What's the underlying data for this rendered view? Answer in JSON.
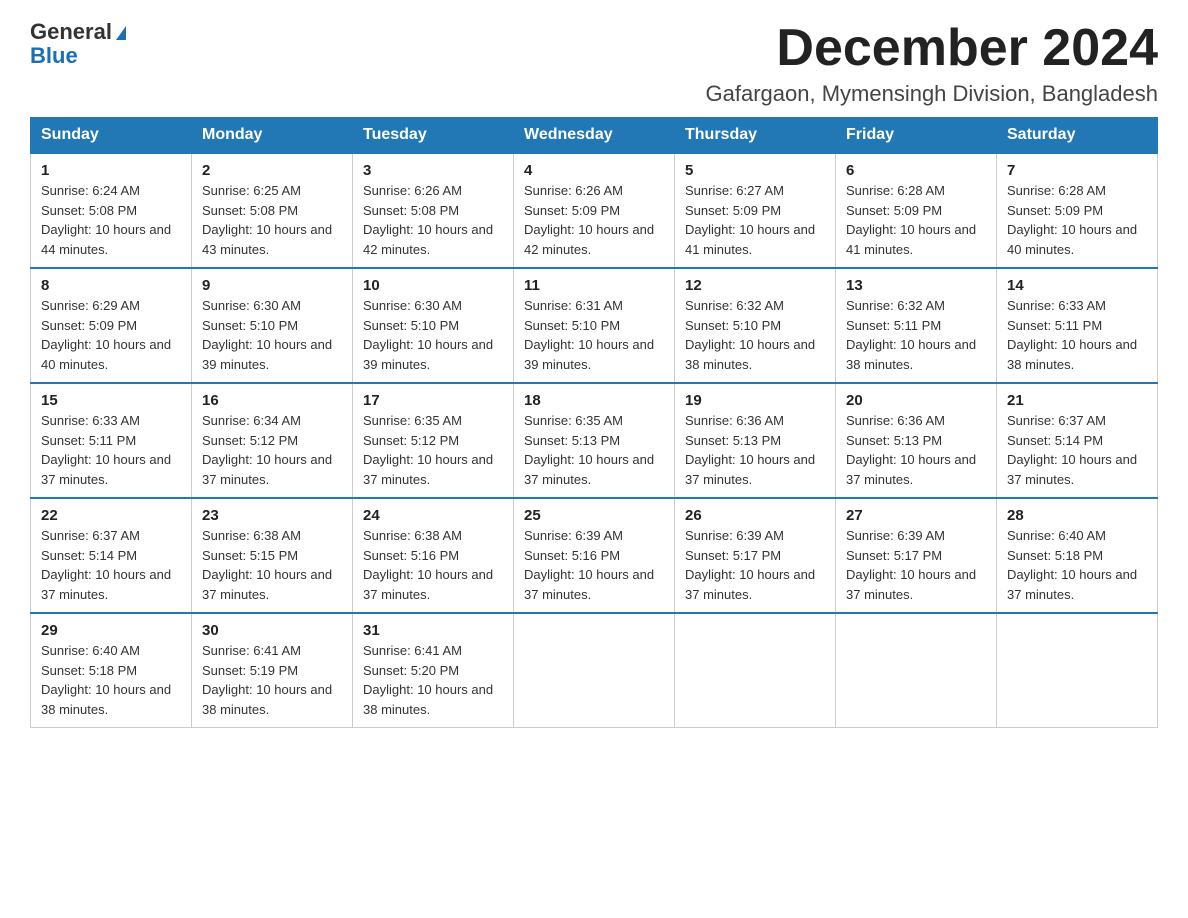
{
  "header": {
    "logo_general": "General",
    "logo_blue": "Blue",
    "month_title": "December 2024",
    "location": "Gafargaon, Mymensingh Division, Bangladesh"
  },
  "weekdays": [
    "Sunday",
    "Monday",
    "Tuesday",
    "Wednesday",
    "Thursday",
    "Friday",
    "Saturday"
  ],
  "weeks": [
    [
      {
        "day": 1,
        "sunrise": "6:24 AM",
        "sunset": "5:08 PM",
        "daylight": "10 hours and 44 minutes."
      },
      {
        "day": 2,
        "sunrise": "6:25 AM",
        "sunset": "5:08 PM",
        "daylight": "10 hours and 43 minutes."
      },
      {
        "day": 3,
        "sunrise": "6:26 AM",
        "sunset": "5:08 PM",
        "daylight": "10 hours and 42 minutes."
      },
      {
        "day": 4,
        "sunrise": "6:26 AM",
        "sunset": "5:09 PM",
        "daylight": "10 hours and 42 minutes."
      },
      {
        "day": 5,
        "sunrise": "6:27 AM",
        "sunset": "5:09 PM",
        "daylight": "10 hours and 41 minutes."
      },
      {
        "day": 6,
        "sunrise": "6:28 AM",
        "sunset": "5:09 PM",
        "daylight": "10 hours and 41 minutes."
      },
      {
        "day": 7,
        "sunrise": "6:28 AM",
        "sunset": "5:09 PM",
        "daylight": "10 hours and 40 minutes."
      }
    ],
    [
      {
        "day": 8,
        "sunrise": "6:29 AM",
        "sunset": "5:09 PM",
        "daylight": "10 hours and 40 minutes."
      },
      {
        "day": 9,
        "sunrise": "6:30 AM",
        "sunset": "5:10 PM",
        "daylight": "10 hours and 39 minutes."
      },
      {
        "day": 10,
        "sunrise": "6:30 AM",
        "sunset": "5:10 PM",
        "daylight": "10 hours and 39 minutes."
      },
      {
        "day": 11,
        "sunrise": "6:31 AM",
        "sunset": "5:10 PM",
        "daylight": "10 hours and 39 minutes."
      },
      {
        "day": 12,
        "sunrise": "6:32 AM",
        "sunset": "5:10 PM",
        "daylight": "10 hours and 38 minutes."
      },
      {
        "day": 13,
        "sunrise": "6:32 AM",
        "sunset": "5:11 PM",
        "daylight": "10 hours and 38 minutes."
      },
      {
        "day": 14,
        "sunrise": "6:33 AM",
        "sunset": "5:11 PM",
        "daylight": "10 hours and 38 minutes."
      }
    ],
    [
      {
        "day": 15,
        "sunrise": "6:33 AM",
        "sunset": "5:11 PM",
        "daylight": "10 hours and 37 minutes."
      },
      {
        "day": 16,
        "sunrise": "6:34 AM",
        "sunset": "5:12 PM",
        "daylight": "10 hours and 37 minutes."
      },
      {
        "day": 17,
        "sunrise": "6:35 AM",
        "sunset": "5:12 PM",
        "daylight": "10 hours and 37 minutes."
      },
      {
        "day": 18,
        "sunrise": "6:35 AM",
        "sunset": "5:13 PM",
        "daylight": "10 hours and 37 minutes."
      },
      {
        "day": 19,
        "sunrise": "6:36 AM",
        "sunset": "5:13 PM",
        "daylight": "10 hours and 37 minutes."
      },
      {
        "day": 20,
        "sunrise": "6:36 AM",
        "sunset": "5:13 PM",
        "daylight": "10 hours and 37 minutes."
      },
      {
        "day": 21,
        "sunrise": "6:37 AM",
        "sunset": "5:14 PM",
        "daylight": "10 hours and 37 minutes."
      }
    ],
    [
      {
        "day": 22,
        "sunrise": "6:37 AM",
        "sunset": "5:14 PM",
        "daylight": "10 hours and 37 minutes."
      },
      {
        "day": 23,
        "sunrise": "6:38 AM",
        "sunset": "5:15 PM",
        "daylight": "10 hours and 37 minutes."
      },
      {
        "day": 24,
        "sunrise": "6:38 AM",
        "sunset": "5:16 PM",
        "daylight": "10 hours and 37 minutes."
      },
      {
        "day": 25,
        "sunrise": "6:39 AM",
        "sunset": "5:16 PM",
        "daylight": "10 hours and 37 minutes."
      },
      {
        "day": 26,
        "sunrise": "6:39 AM",
        "sunset": "5:17 PM",
        "daylight": "10 hours and 37 minutes."
      },
      {
        "day": 27,
        "sunrise": "6:39 AM",
        "sunset": "5:17 PM",
        "daylight": "10 hours and 37 minutes."
      },
      {
        "day": 28,
        "sunrise": "6:40 AM",
        "sunset": "5:18 PM",
        "daylight": "10 hours and 37 minutes."
      }
    ],
    [
      {
        "day": 29,
        "sunrise": "6:40 AM",
        "sunset": "5:18 PM",
        "daylight": "10 hours and 38 minutes."
      },
      {
        "day": 30,
        "sunrise": "6:41 AM",
        "sunset": "5:19 PM",
        "daylight": "10 hours and 38 minutes."
      },
      {
        "day": 31,
        "sunrise": "6:41 AM",
        "sunset": "5:20 PM",
        "daylight": "10 hours and 38 minutes."
      },
      null,
      null,
      null,
      null
    ]
  ]
}
